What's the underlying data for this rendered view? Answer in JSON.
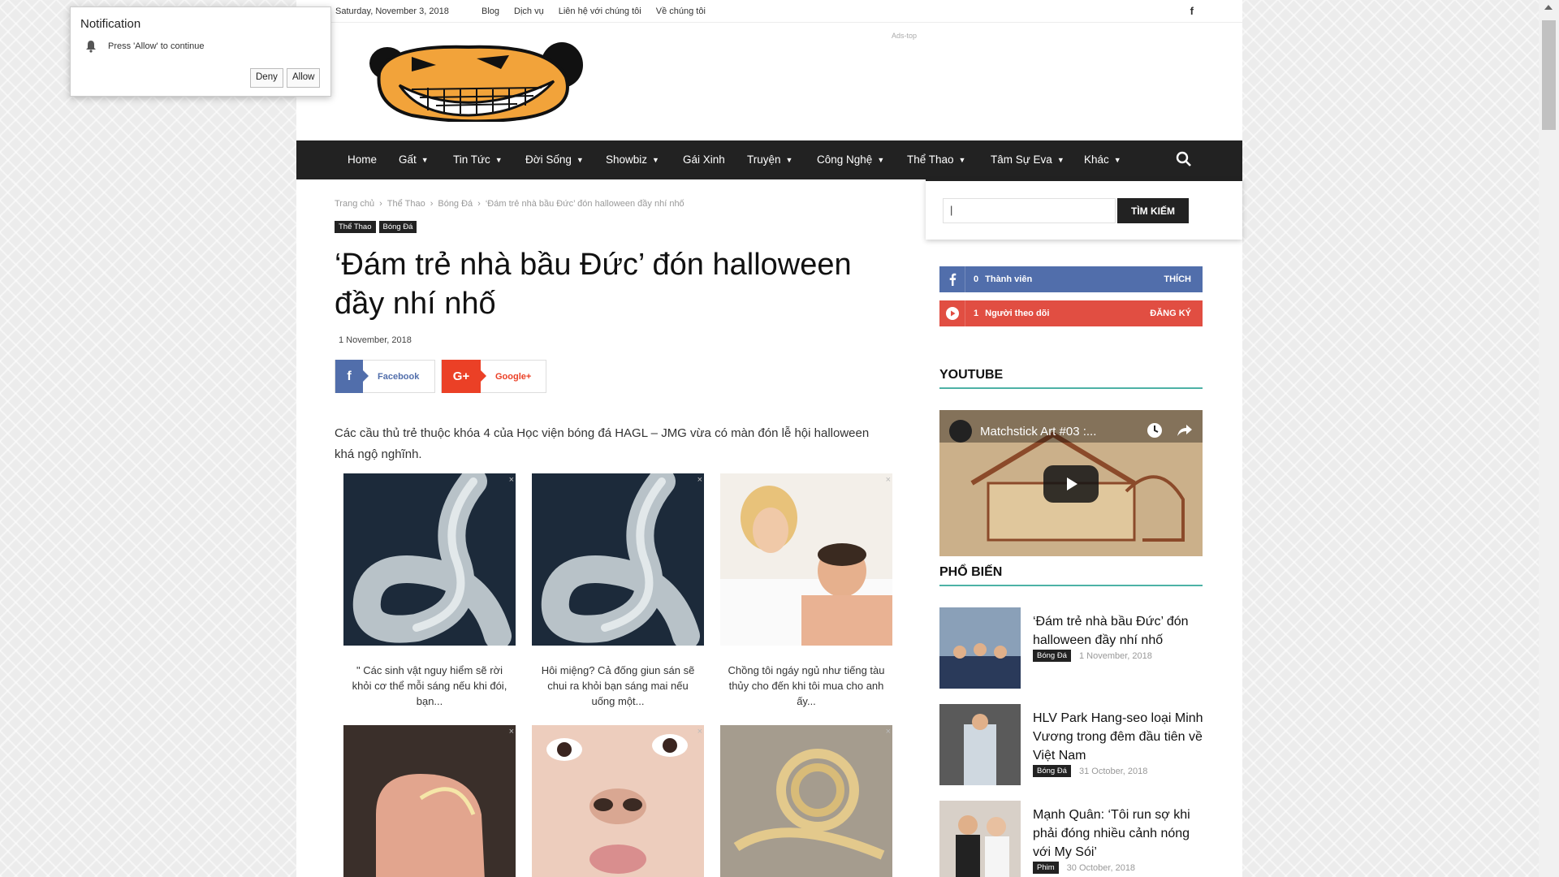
{
  "notification": {
    "title": "Notification",
    "message": "Press 'Allow' to continue",
    "deny": "Deny",
    "allow": "Allow"
  },
  "topbar": {
    "date": "Saturday, November 3, 2018",
    "links": [
      "Blog",
      "Dịch vụ",
      "Liên hệ với chúng tôi",
      "Về chúng tôi"
    ],
    "social_icon": "f"
  },
  "ads_top": "Ads-top",
  "nav": {
    "items": [
      {
        "label": "Home",
        "dropdown": false
      },
      {
        "label": "Gất",
        "dropdown": true
      },
      {
        "label": "Tin Tức",
        "dropdown": true
      },
      {
        "label": "Đời Sống",
        "dropdown": true
      },
      {
        "label": "Showbiz",
        "dropdown": true
      },
      {
        "label": "Gái Xinh",
        "dropdown": false
      },
      {
        "label": "Truyện",
        "dropdown": true
      },
      {
        "label": "Công Nghệ",
        "dropdown": true
      },
      {
        "label": "Thể Thao",
        "dropdown": true
      },
      {
        "label": "Tâm Sự Eva",
        "dropdown": true
      },
      {
        "label": "Khác",
        "dropdown": true
      }
    ]
  },
  "search": {
    "button": "TÌM KIẾM",
    "value": "|"
  },
  "breadcrumb": [
    "Trang chủ",
    "Thể Thao",
    "Bóng Đá",
    "‘Đám trẻ nhà bầu Đức’ đón halloween đầy nhí nhố"
  ],
  "tags": [
    "Thể Thao",
    "Bóng Đá"
  ],
  "article": {
    "title": "‘Đám trẻ nhà bầu Đức’ đón halloween đầy nhí nhố",
    "date": "1 November, 2018",
    "share_facebook": "Facebook",
    "share_google": "Google+",
    "share_google_icon": "G+",
    "share_facebook_icon": "f",
    "intro": "Các cầu thủ trẻ thuộc khóa 4 của Học viện bóng đá HAGL – JMG vừa có màn đón lễ hội halloween khá ngộ nghĩnh."
  },
  "ads": [
    {
      "caption": "\" Các sinh vật nguy hiểm sẽ rời khỏi cơ thể mỗi sáng nếu khi đói, bạn...",
      "image": "worm"
    },
    {
      "caption": "Hôi miệng? Cả đống giun sán sẽ chui ra khỏi bạn sáng mai nếu uống một...",
      "image": "worm"
    },
    {
      "caption": "Chồng tôi ngáy ngủ như tiếng tàu thủy cho đến khi tôi mua cho anh ấy...",
      "image": "couple"
    },
    {
      "caption": "",
      "image": "finger"
    },
    {
      "caption": "",
      "image": "face"
    },
    {
      "caption": "",
      "image": "coil"
    }
  ],
  "ad_close": "×",
  "sidebar": {
    "facebook": {
      "count": "0",
      "label": "Thành viên",
      "action": "THÍCH"
    },
    "youtube": {
      "count": "1",
      "label": "Người theo dõi",
      "action": "ĐĂNG KÝ"
    },
    "youtube_title": "YOUTUBE",
    "video_title": "Matchstick Art #03 :...",
    "popular_title": "PHỔ BIẾN",
    "popular": [
      {
        "title": "‘Đám trẻ nhà bầu Đức’ đón halloween đầy nhí nhố",
        "tag": "Bóng Đá",
        "date": "1 November, 2018"
      },
      {
        "title": "HLV Park Hang-seo loại Minh Vương trong đêm đầu tiên về Việt Nam",
        "tag": "Bóng Đá",
        "date": "31 October, 2018"
      },
      {
        "title": "Mạnh Quân: ‘Tôi run sợ khi phải đóng nhiều cảnh nóng với My Sói’",
        "tag": "Phim",
        "date": "30 October, 2018"
      }
    ]
  }
}
